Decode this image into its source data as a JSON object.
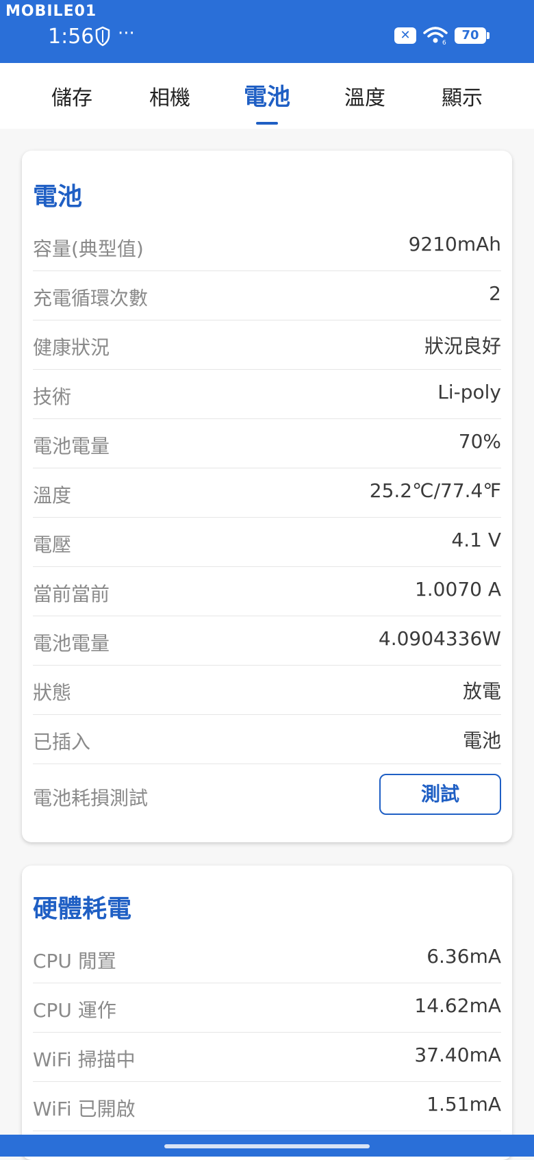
{
  "status_bar": {
    "watermark": "MOBILE01",
    "time": "1:56",
    "more": "···",
    "x_badge": "✕",
    "battery_level": "70"
  },
  "tabs": [
    {
      "label": "儲存",
      "active": false
    },
    {
      "label": "相機",
      "active": false
    },
    {
      "label": "電池",
      "active": true
    },
    {
      "label": "溫度",
      "active": false
    },
    {
      "label": "顯示",
      "active": false
    }
  ],
  "battery_card": {
    "title": "電池",
    "rows": [
      {
        "label": "容量(典型值)",
        "value": "9210mAh"
      },
      {
        "label": "充電循環次數",
        "value": "2"
      },
      {
        "label": "健康狀況",
        "value": "狀況良好"
      },
      {
        "label": "技術",
        "value": "Li-poly"
      },
      {
        "label": "電池電量",
        "value": "70%"
      },
      {
        "label": "溫度",
        "value": "25.2℃/77.4℉"
      },
      {
        "label": "電壓",
        "value": "4.1 V"
      },
      {
        "label": "當前當前",
        "value": "1.0070 A"
      },
      {
        "label": "電池電量",
        "value": "4.0904336W"
      },
      {
        "label": "狀態",
        "value": "放電"
      },
      {
        "label": "已插入",
        "value": "電池"
      }
    ],
    "test_label": "電池耗損測試",
    "test_button": "測試"
  },
  "hardware_card": {
    "title": "硬體耗電",
    "rows": [
      {
        "label": "CPU 閒置",
        "value": "6.36mA"
      },
      {
        "label": "CPU 運作",
        "value": "14.62mA"
      },
      {
        "label": "WiFi 掃描中",
        "value": "37.40mA"
      },
      {
        "label": "WiFi 已開啟",
        "value": "1.51mA"
      }
    ]
  },
  "colors": {
    "accent": "#1f5fc4",
    "status_bar": "#2a6fd8"
  }
}
